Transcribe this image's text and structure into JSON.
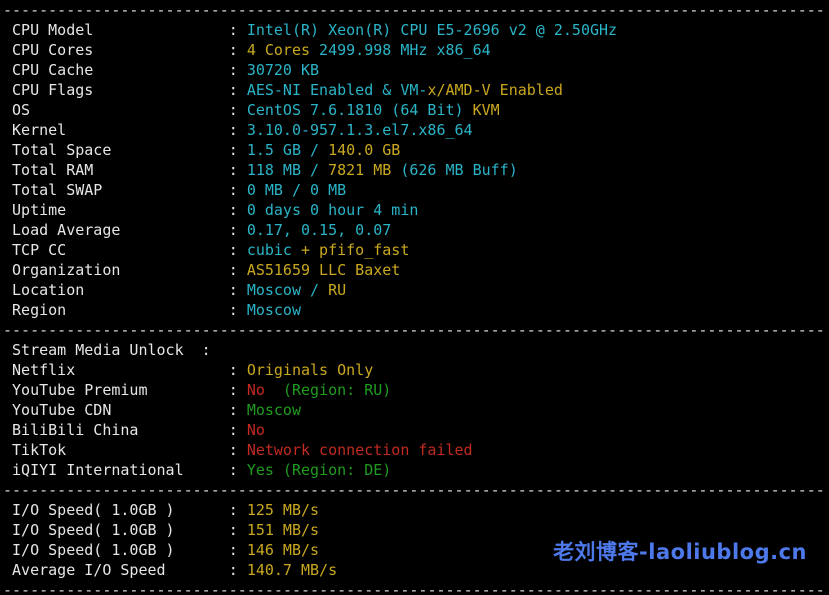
{
  "terminal": {
    "colors": {
      "white": "#e6e6e6",
      "cyan": "#2ab4c7",
      "yellow": "#c9a81f",
      "red": "#c12a21",
      "green": "#1f9c1f",
      "gray": "#d9d9d9"
    },
    "separator": {
      "char": "-",
      "count": 91
    },
    "rows": [
      {
        "type": "sep"
      },
      {
        "type": "kv",
        "label": "CPU Model",
        "value": [
          {
            "t": "Intel(R) Xeon(R) CPU E5-2696 v2 @ 2.50GHz",
            "c": "cyan"
          }
        ]
      },
      {
        "type": "kv",
        "label": "CPU Cores",
        "value": [
          {
            "t": "4 Cores",
            "c": "yellow"
          },
          {
            "t": " 2499.998 MHz x86_64",
            "c": "cyan"
          }
        ]
      },
      {
        "type": "kv",
        "label": "CPU Cache",
        "value": [
          {
            "t": "30720 KB",
            "c": "cyan"
          }
        ]
      },
      {
        "type": "kv",
        "label": "CPU Flags",
        "value": [
          {
            "t": "AES-NI Enabled & VM-",
            "c": "cyan"
          },
          {
            "t": "x/AMD-V Enabled",
            "c": "yellow"
          }
        ]
      },
      {
        "type": "kv",
        "label": "OS",
        "value": [
          {
            "t": "CentOS 7.6.1810 (64 Bit)",
            "c": "cyan"
          },
          {
            "t": " KVM",
            "c": "yellow"
          }
        ]
      },
      {
        "type": "kv",
        "label": "Kernel",
        "value": [
          {
            "t": "3.10.0-957.1.3.el7.x86_64",
            "c": "cyan"
          }
        ]
      },
      {
        "type": "kv",
        "label": "Total Space",
        "value": [
          {
            "t": "1.5 GB / ",
            "c": "cyan"
          },
          {
            "t": "140.0 GB",
            "c": "yellow"
          }
        ]
      },
      {
        "type": "kv",
        "label": "Total RAM",
        "value": [
          {
            "t": "118 MB / ",
            "c": "cyan"
          },
          {
            "t": "7821 MB",
            "c": "yellow"
          },
          {
            "t": " (626 MB Buff)",
            "c": "cyan"
          }
        ]
      },
      {
        "type": "kv",
        "label": "Total SWAP",
        "value": [
          {
            "t": "0 MB / 0 MB",
            "c": "cyan"
          }
        ]
      },
      {
        "type": "kv",
        "label": "Uptime",
        "value": [
          {
            "t": "0 days 0 hour 4 min",
            "c": "cyan"
          }
        ]
      },
      {
        "type": "kv",
        "label": "Load Average",
        "value": [
          {
            "t": "0.17, 0.15, 0.07",
            "c": "cyan"
          }
        ]
      },
      {
        "type": "kv",
        "label": "TCP CC",
        "value": [
          {
            "t": "cubic",
            "c": "cyan"
          },
          {
            "t": " + pfifo_fast",
            "c": "yellow"
          }
        ]
      },
      {
        "type": "kv",
        "label": "Organization",
        "value": [
          {
            "t": "AS51659 LLC Baxet",
            "c": "yellow"
          }
        ]
      },
      {
        "type": "kv",
        "label": "Location",
        "value": [
          {
            "t": "Moscow / ",
            "c": "cyan"
          },
          {
            "t": "RU",
            "c": "yellow"
          }
        ]
      },
      {
        "type": "kv",
        "label": "Region",
        "value": [
          {
            "t": "Moscow",
            "c": "cyan"
          }
        ]
      },
      {
        "type": "sep"
      },
      {
        "type": "kv",
        "label": "Stream Media Unlock",
        "pad": 20,
        "value": []
      },
      {
        "type": "kv",
        "label": "Netflix",
        "value": [
          {
            "t": "Originals Only",
            "c": "yellow"
          }
        ]
      },
      {
        "type": "kv",
        "label": "YouTube Premium",
        "value": [
          {
            "t": "No",
            "c": "red"
          },
          {
            "t": "  (Region: RU)",
            "c": "green"
          }
        ]
      },
      {
        "type": "kv",
        "label": "YouTube CDN",
        "value": [
          {
            "t": "Moscow",
            "c": "green"
          }
        ]
      },
      {
        "type": "kv",
        "label": "BiliBili China",
        "value": [
          {
            "t": "No",
            "c": "red"
          }
        ]
      },
      {
        "type": "kv",
        "label": "TikTok",
        "value": [
          {
            "t": "Network connection failed",
            "c": "red"
          }
        ]
      },
      {
        "type": "kv",
        "label": "iQIYI International",
        "value": [
          {
            "t": "Yes (Region: DE)",
            "c": "green"
          }
        ]
      },
      {
        "type": "sep"
      },
      {
        "type": "kv",
        "label": "I/O Speed( 1.0GB )",
        "value": [
          {
            "t": "125 MB/s",
            "c": "yellow"
          }
        ]
      },
      {
        "type": "kv",
        "label": "I/O Speed( 1.0GB )",
        "value": [
          {
            "t": "151 MB/s",
            "c": "yellow"
          }
        ]
      },
      {
        "type": "kv",
        "label": "I/O Speed( 1.0GB )",
        "value": [
          {
            "t": "146 MB/s",
            "c": "yellow"
          }
        ]
      },
      {
        "type": "kv",
        "label": "Average I/O Speed",
        "value": [
          {
            "t": "140.7 MB/s",
            "c": "yellow"
          }
        ]
      },
      {
        "type": "sep"
      }
    ]
  },
  "watermark": {
    "text": "老刘博客-laoliublog.cn",
    "color": "#4d79ea"
  }
}
